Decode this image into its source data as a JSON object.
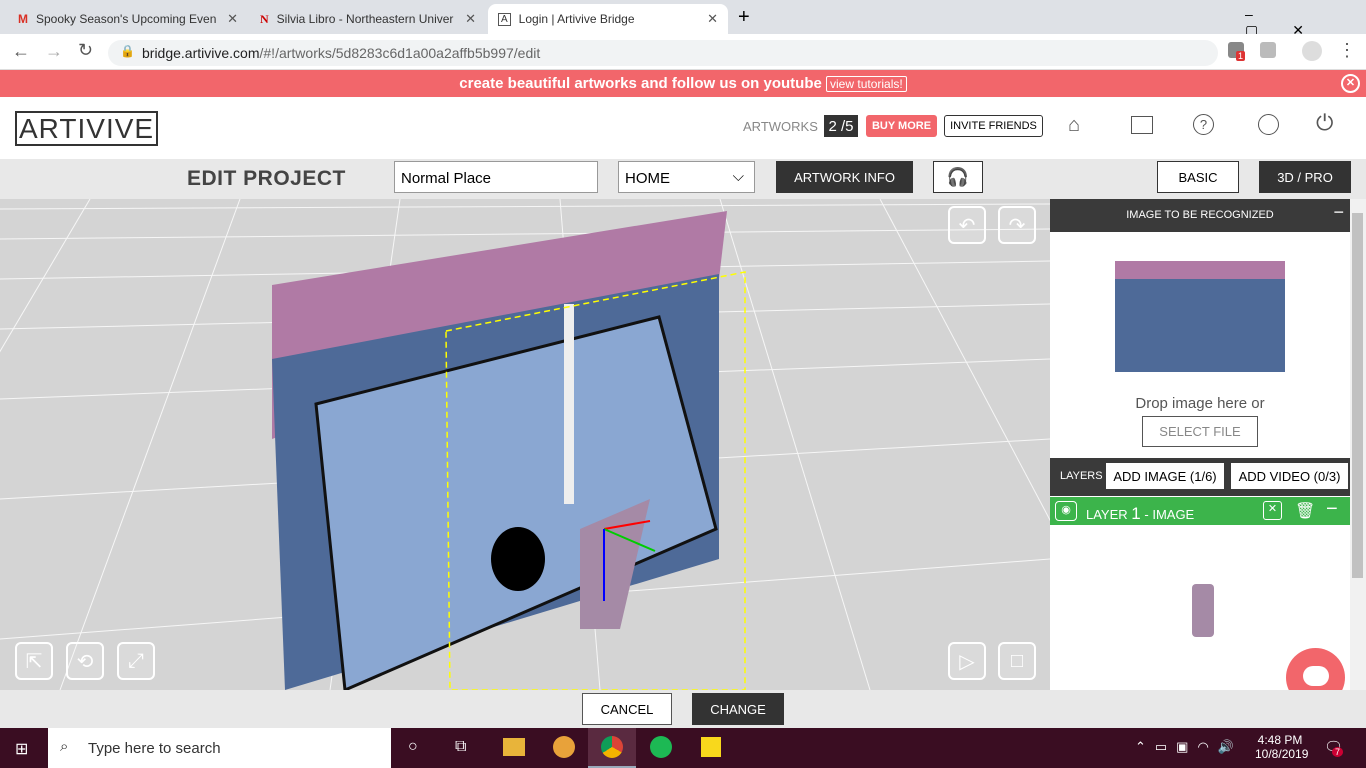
{
  "browser": {
    "tabs": [
      {
        "title": "Spooky Season's Upcoming Even",
        "icon": "gmail-icon"
      },
      {
        "title": "Silvia Libro - Northeastern Univer",
        "icon": "northeastern-icon"
      },
      {
        "title": "Login | Artivive Bridge",
        "icon": "artivive-icon"
      }
    ],
    "url_host": "bridge.artivive.com",
    "url_path": "/#!/artworks/5d8283c6d1a00a2affb5b997/edit",
    "extension_badge": "1"
  },
  "banner": {
    "text": "create beautiful artworks and follow us on youtube",
    "link": "view tutorials!",
    "bg": "#f2666b"
  },
  "header": {
    "logo": "ARTIVIVE",
    "artworks_label": "ARTWORKS",
    "artworks_count": "2 /5",
    "buy_more": "BUY MORE",
    "invite": "INVITE FRIENDS"
  },
  "toolbar": {
    "title": "EDIT PROJECT",
    "name_value": "Normal Place",
    "select_value": "HOME",
    "artwork_info": "ARTWORK INFO",
    "basic": "BASIC",
    "pro": "3D / PRO"
  },
  "panel": {
    "recognize_title": "IMAGE TO BE RECOGNIZED",
    "drop_text": "Drop image here or",
    "select_file": "SELECT FILE",
    "layers_label": "LAYERS",
    "add_image": "ADD IMAGE (1/6)",
    "add_video": "ADD VIDEO (0/3)",
    "layer_prefix": "LAYER",
    "layer_num": "1",
    "layer_suffix": "- IMAGE",
    "layer_color": "#3cb44b"
  },
  "footer": {
    "cancel": "CANCEL",
    "change": "CHANGE"
  },
  "taskbar": {
    "search": "Type here to search",
    "time": "4:48 PM",
    "date": "10/8/2019",
    "notifications": "7"
  }
}
